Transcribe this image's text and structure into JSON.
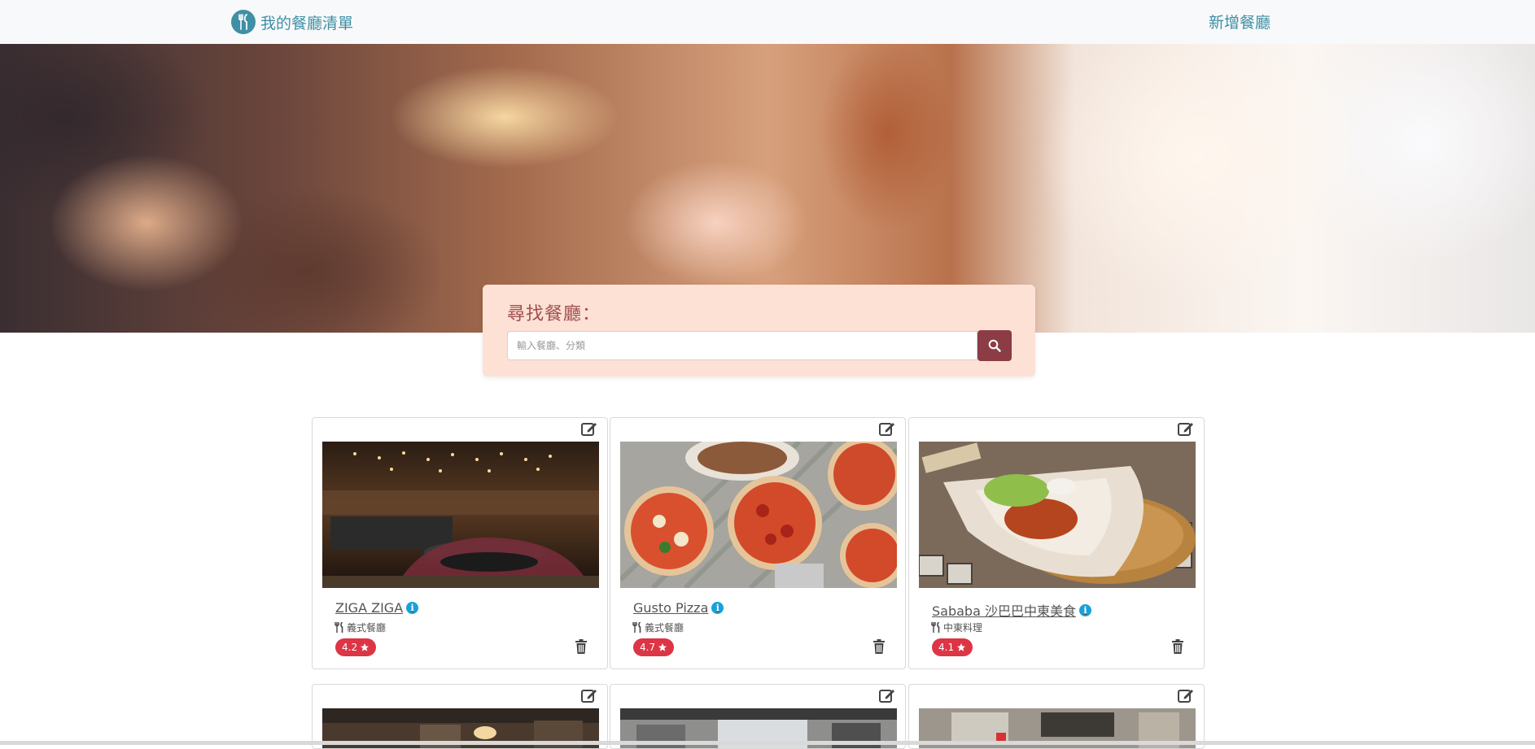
{
  "navbar": {
    "brand": "我的餐廳清單",
    "brand_icon": "utensils-icon",
    "new_restaurant": "新增餐廳"
  },
  "search": {
    "title": "尋找餐廳：",
    "placeholder": "輸入餐廳、分類",
    "button_icon": "search-icon"
  },
  "colors": {
    "brand": "#3f8fa6",
    "search_bg": "#fde1d5",
    "search_button": "#8c3c45",
    "rating_badge": "#dc3545",
    "info": "#17a2d8"
  },
  "restaurants": [
    {
      "name": "ZIGA ZIGA",
      "category": "義式餐廳",
      "rating": "4.2",
      "image": "restaurant-interior-photo"
    },
    {
      "name": "Gusto Pizza",
      "category": "義式餐廳",
      "rating": "4.7",
      "image": "pizza-photo"
    },
    {
      "name": "Sababa 沙巴巴中東美食",
      "category": "中東料理",
      "rating": "4.1",
      "image": "pita-wrap-photo"
    }
  ]
}
